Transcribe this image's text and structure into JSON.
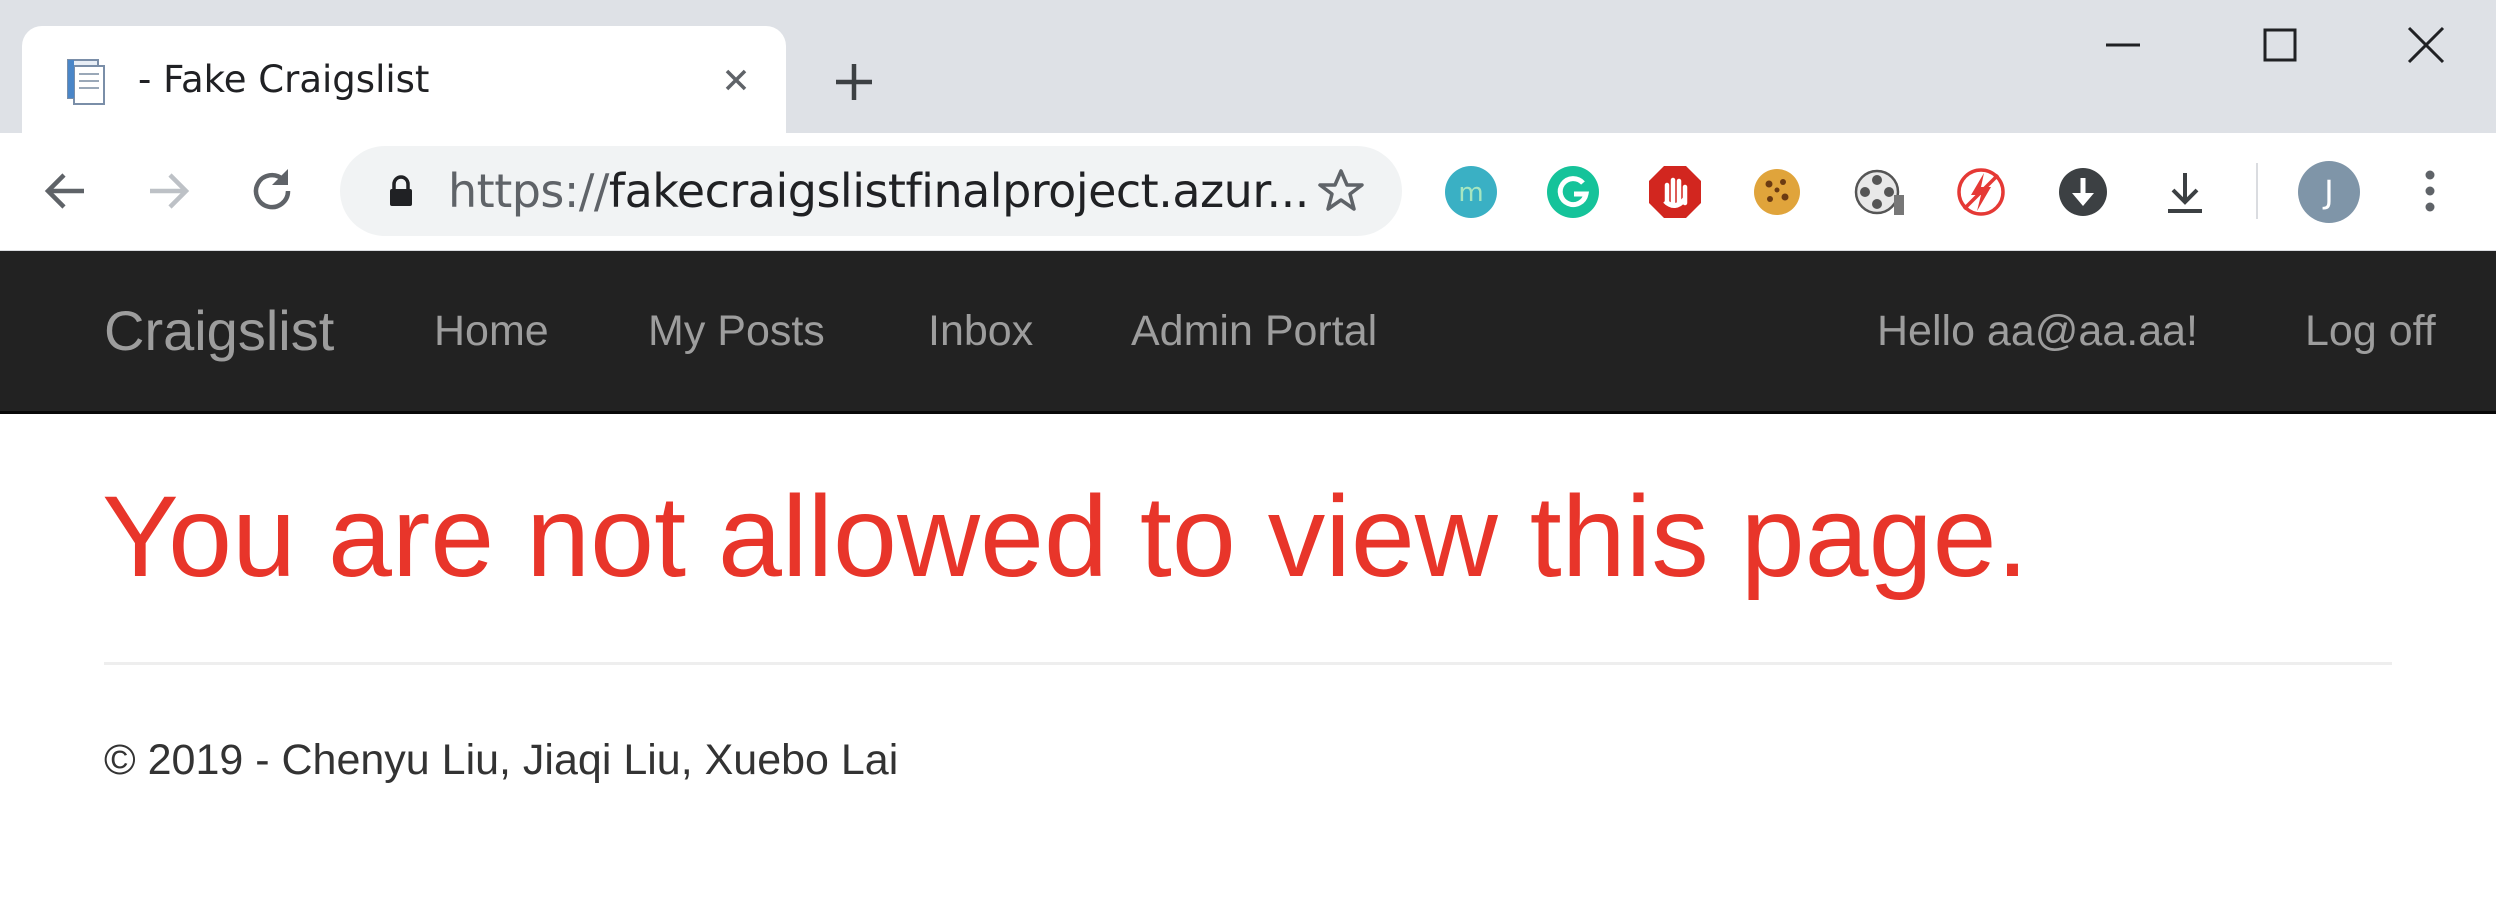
{
  "browser": {
    "tab": {
      "title": "- Fake Craigslist"
    },
    "url": {
      "scheme": "https://",
      "rest": "fakecraigslistfinalproject.azur..."
    },
    "profile_initial": "J",
    "extensions": [
      "mercury-reader-icon",
      "grammarly-icon",
      "adblock-icon",
      "cookie-icon",
      "film-reel-icon",
      "lightning-blocked-icon",
      "download-circle-icon"
    ]
  },
  "navbar": {
    "brand": "Craigslist",
    "links": [
      "Home",
      "My Posts",
      "Inbox",
      "Admin Portal"
    ],
    "greeting": "Hello aa@aa.aa!",
    "logoff": "Log off"
  },
  "main": {
    "error_message": "You are not allowed to view this page."
  },
  "footer": {
    "copyright": "© 2019 - Chenyu Liu, Jiaqi Liu, Xuebo Lai"
  },
  "colors": {
    "navbar_bg": "#222222",
    "nav_text": "#9d9d9d",
    "error_text": "#e8352a",
    "tabstrip_bg": "#dee1e6"
  }
}
